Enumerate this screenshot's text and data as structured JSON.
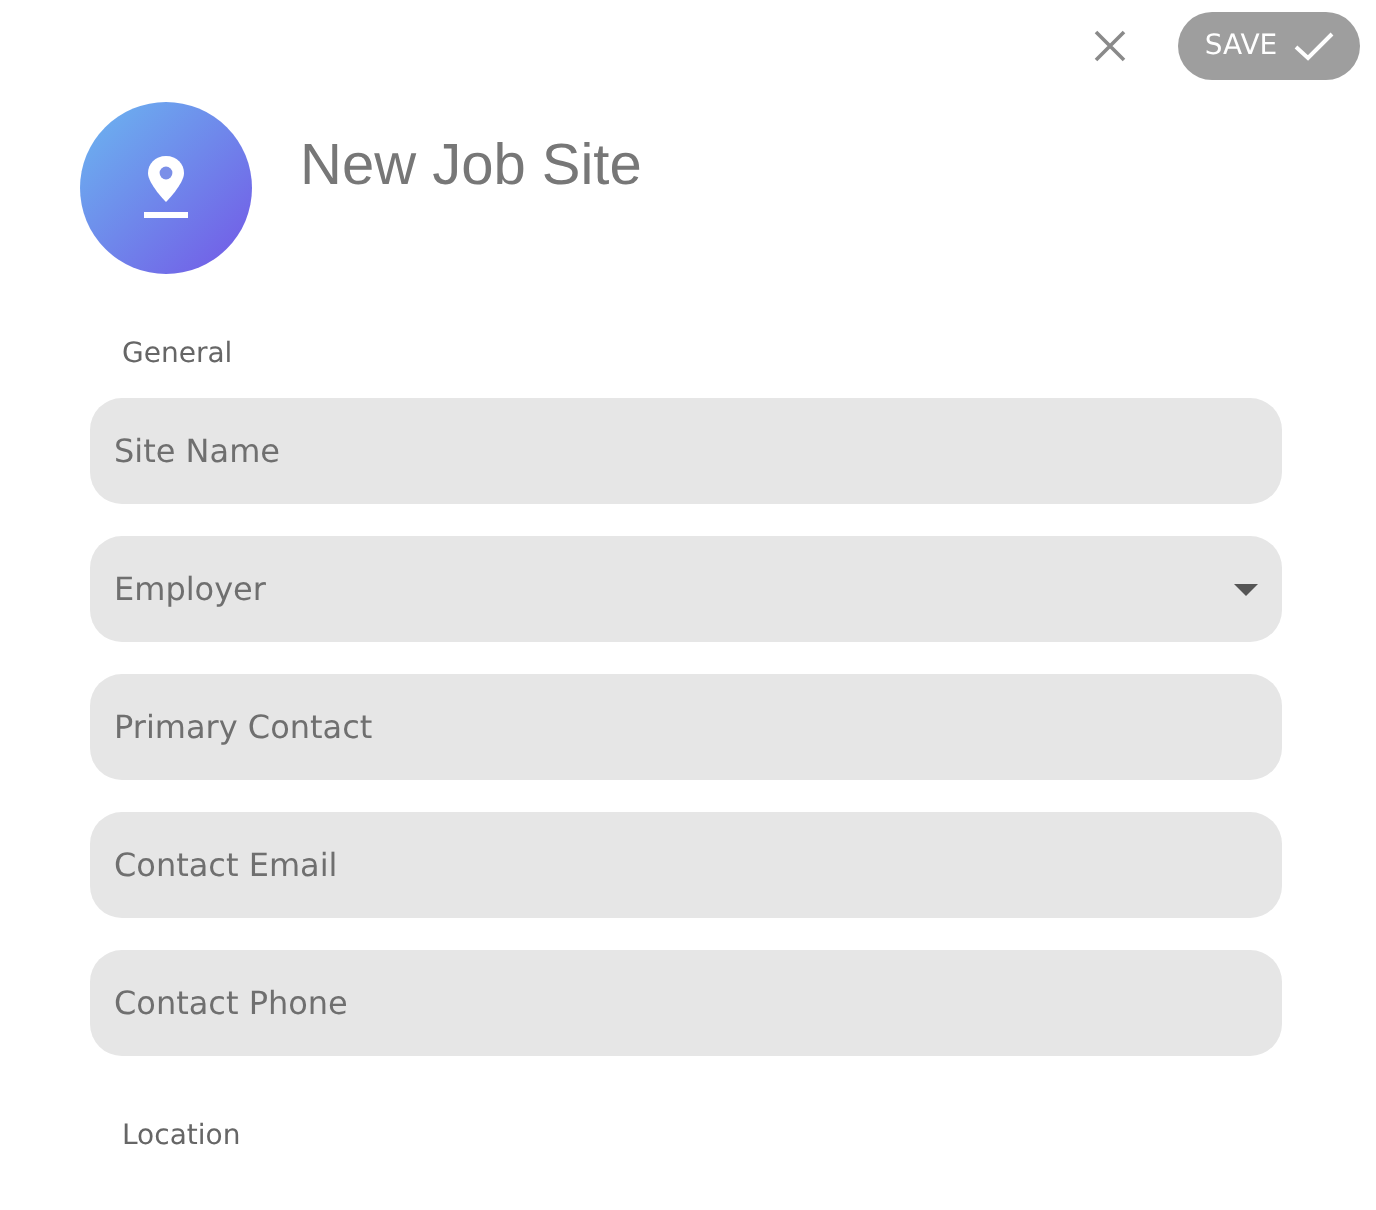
{
  "header": {
    "title": "New Job Site",
    "save_label": "SAVE"
  },
  "sections": [
    {
      "title": "General",
      "fields": [
        {
          "kind": "text",
          "placeholder": "Site Name"
        },
        {
          "kind": "select",
          "placeholder": "Employer"
        },
        {
          "kind": "text",
          "placeholder": "Primary Contact"
        },
        {
          "kind": "text",
          "placeholder": "Contact Email"
        },
        {
          "kind": "text",
          "placeholder": "Contact Phone"
        }
      ]
    },
    {
      "title": "Location"
    }
  ]
}
